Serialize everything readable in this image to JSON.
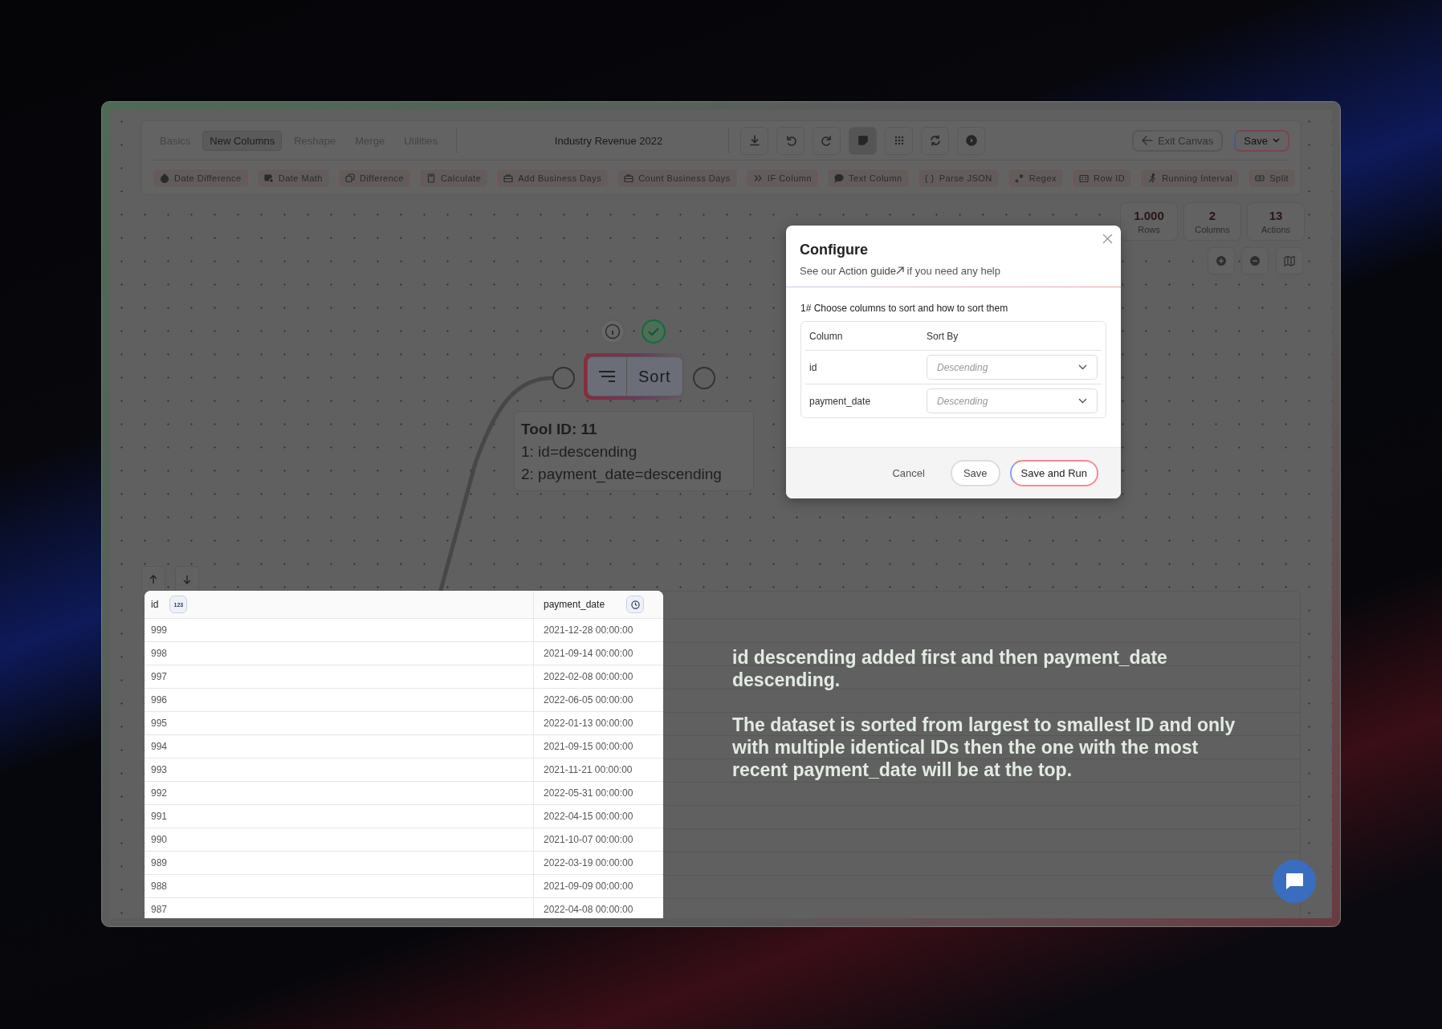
{
  "toolbar": {
    "tabs": [
      {
        "label": "Basics",
        "selected": false
      },
      {
        "label": "New Columns",
        "selected": true
      },
      {
        "label": "Reshape",
        "selected": false
      },
      {
        "label": "Merge",
        "selected": false
      },
      {
        "label": "Utilities",
        "selected": false
      }
    ],
    "title": "Industry Revenue 2022",
    "tool_buttons": [
      {
        "kind": "download",
        "selected": false
      },
      {
        "kind": "undo",
        "selected": false
      },
      {
        "kind": "redo",
        "selected": false
      },
      {
        "kind": "note",
        "selected": true
      },
      {
        "kind": "grid",
        "selected": false
      },
      {
        "kind": "refresh",
        "selected": false
      },
      {
        "kind": "play",
        "selected": false
      }
    ],
    "exit_button": "Exit Canvas",
    "save_menu": "Save"
  },
  "actions": [
    {
      "label": "Date Difference",
      "kind": "stopwatch"
    },
    {
      "label": "Date Math",
      "kind": "calendar"
    },
    {
      "label": "Difference",
      "kind": "squares"
    },
    {
      "label": "Calculate",
      "kind": "calculator"
    },
    {
      "label": "Add Business Days",
      "kind": "briefcase"
    },
    {
      "label": "Count Business Days",
      "kind": "briefcase"
    },
    {
      "label": "IF Column",
      "kind": "chevrons"
    },
    {
      "label": "Text Column",
      "kind": "chat"
    },
    {
      "label": "Parse JSON",
      "kind": "glyph",
      "glyph": "{ }"
    },
    {
      "label": "Regex",
      "kind": "regex"
    },
    {
      "label": "Row ID",
      "kind": "card"
    },
    {
      "label": "Running Interval",
      "kind": "runner"
    },
    {
      "label": "Split",
      "kind": "split"
    }
  ],
  "stats": [
    {
      "value": "1.000",
      "label": "Rows"
    },
    {
      "value": "2",
      "label": "Columns"
    },
    {
      "value": "13",
      "label": "Actions"
    }
  ],
  "node": {
    "title": "Sort",
    "summary_title": "Tool ID: 11",
    "summary_lines": [
      "1: id=descending",
      "2: payment_date=descending"
    ]
  },
  "dialog": {
    "title": "Configure",
    "help_prefix": "See our",
    "help_link": "Action guide",
    "help_suffix": "if you need any help",
    "step": "1# Choose columns to sort and how to sort them",
    "columns": [
      "Column",
      "Sort By"
    ],
    "rows": [
      {
        "column": "id",
        "placeholder": "Descending"
      },
      {
        "column": "payment_date",
        "placeholder": "Descending"
      }
    ],
    "buttons": {
      "cancel": "Cancel",
      "save": "Save",
      "save_run": "Save and Run"
    }
  },
  "table": {
    "columns": [
      {
        "name": "id",
        "kind": "number",
        "badge": "123"
      },
      {
        "name": "payment_date",
        "kind": "datetime"
      }
    ],
    "rows": [
      [
        "999",
        "2021-12-28 00:00:00"
      ],
      [
        "998",
        "2021-09-14 00:00:00"
      ],
      [
        "997",
        "2022-02-08 00:00:00"
      ],
      [
        "996",
        "2022-06-05 00:00:00"
      ],
      [
        "995",
        "2022-01-13 00:00:00"
      ],
      [
        "994",
        "2021-09-15 00:00:00"
      ],
      [
        "993",
        "2021-11-21 00:00:00"
      ],
      [
        "992",
        "2022-05-31 00:00:00"
      ],
      [
        "991",
        "2022-04-15 00:00:00"
      ],
      [
        "990",
        "2021-10-07 00:00:00"
      ],
      [
        "989",
        "2022-03-19 00:00:00"
      ],
      [
        "988",
        "2021-09-09 00:00:00"
      ],
      [
        "987",
        "2022-04-08 00:00:00"
      ]
    ]
  },
  "note": [
    "id descending added first and then payment_date descending.",
    "The dataset is sorted from largest to smallest ID and only with multiple identical IDs then the one with the most recent payment_date will be at the top."
  ]
}
